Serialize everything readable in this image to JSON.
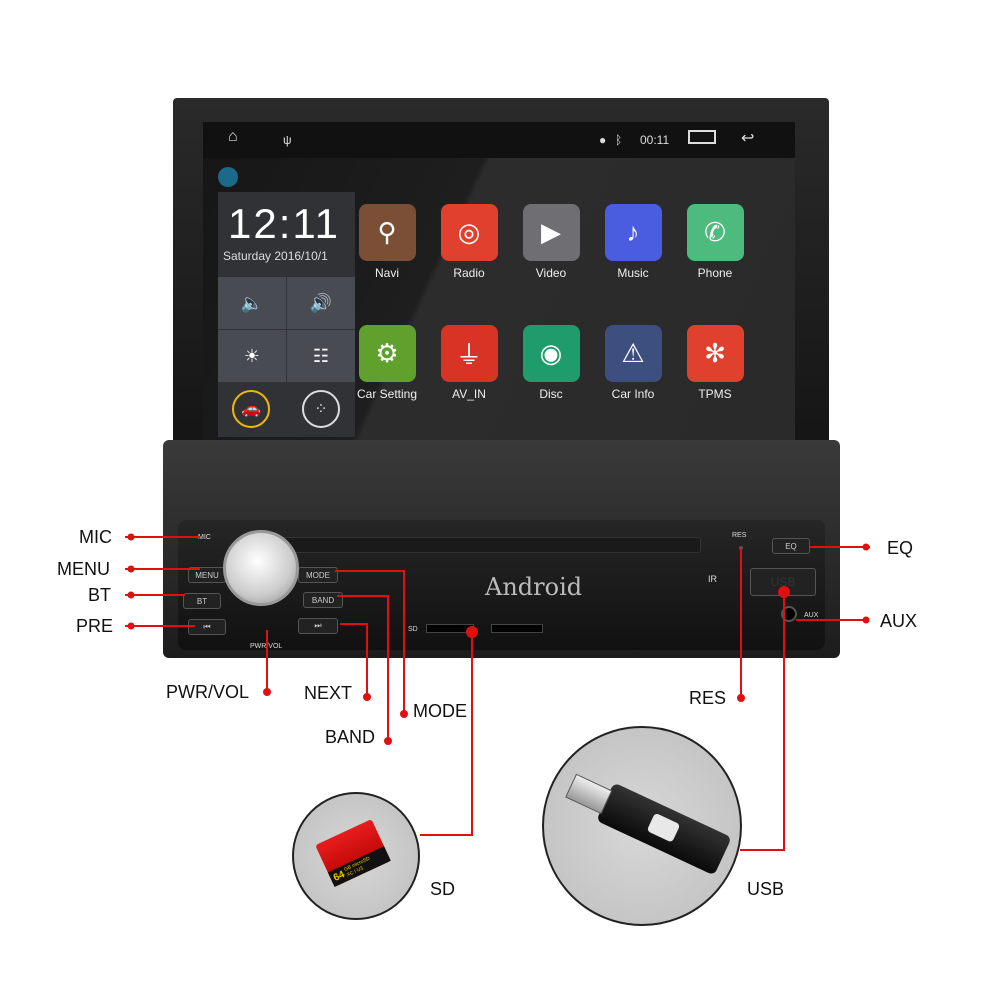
{
  "status_bar": {
    "time": "00:11",
    "icons": [
      "home-icon",
      "usb-icon",
      "location-icon",
      "bluetooth-icon",
      "recent-apps-icon",
      "back-icon"
    ]
  },
  "widget": {
    "time": "12:11",
    "date": "Saturday 2016/10/1",
    "quick": [
      "volume-down-icon",
      "volume-up-icon",
      "brightness-icon",
      "equalizer-icon"
    ],
    "bottom": [
      "car-icon",
      "apps-icon"
    ],
    "car_color": "#f2b705"
  },
  "apps": [
    {
      "label": "Navi",
      "color": "#7a4f35",
      "icon": "map-pin-icon",
      "glyph": "⚲"
    },
    {
      "label": "Radio",
      "color": "#e2402f",
      "icon": "radio-icon",
      "glyph": "◎"
    },
    {
      "label": "Video",
      "color": "#6f6f73",
      "icon": "video-icon",
      "glyph": "▶"
    },
    {
      "label": "Music",
      "color": "#4a5de0",
      "icon": "music-icon",
      "glyph": "♪"
    },
    {
      "label": "Phone",
      "color": "#4dbb7e",
      "icon": "phone-icon",
      "glyph": "✆"
    },
    {
      "label": "Car Setting",
      "color": "#5fa12c",
      "icon": "gear-icon",
      "glyph": "⚙"
    },
    {
      "label": "AV_IN",
      "color": "#d93326",
      "icon": "av-in-icon",
      "glyph": "⏚"
    },
    {
      "label": "Disc",
      "color": "#1f9c6c",
      "icon": "disc-icon",
      "glyph": "◉"
    },
    {
      "label": "Car Info",
      "color": "#3d4f7e",
      "icon": "car-info-icon",
      "glyph": "⚠"
    },
    {
      "label": "TPMS",
      "color": "#e0402e",
      "icon": "tire-icon",
      "glyph": "✻"
    }
  ],
  "panel": {
    "mic": "MIC",
    "menu": "MENU",
    "bt": "BT",
    "prev": "⏮",
    "mode": "MODE",
    "band": "BAND",
    "next": "⏭",
    "pwr": "PWR/VOL",
    "brand": "Android",
    "sd": "SD",
    "res": "RES",
    "eq": "EQ",
    "usb": "USB",
    "aux": "AUX",
    "ir": "IR"
  },
  "callouts": {
    "mic": "MIC",
    "menu": "MENU",
    "bt": "BT",
    "pre": "PRE",
    "pwr": "PWR/VOL",
    "next": "NEXT",
    "mode": "MODE",
    "band": "BAND",
    "res": "RES",
    "eq": "EQ",
    "aux": "AUX",
    "sd": "SD",
    "usb": "USB"
  },
  "sd_card": {
    "capacity": "64",
    "marks": "GB microSD XC I U3"
  },
  "callout_color": "#e01010"
}
